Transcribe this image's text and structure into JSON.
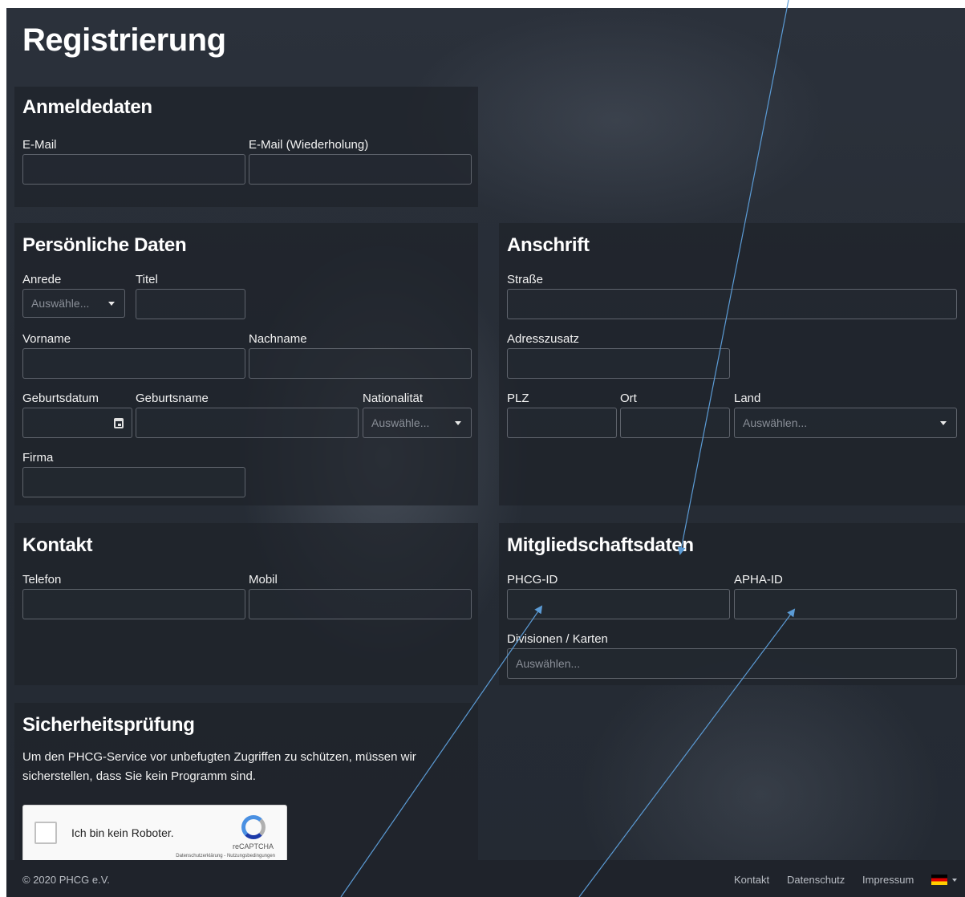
{
  "page_title": "Registrierung",
  "login": {
    "heading": "Anmeldedaten",
    "email_label": "E-Mail",
    "email_repeat_label": "E-Mail (Wiederholung)"
  },
  "personal": {
    "heading": "Persönliche Daten",
    "salutation_label": "Anrede",
    "salutation_placeholder": "Auswähle...",
    "title_label": "Titel",
    "firstname_label": "Vorname",
    "lastname_label": "Nachname",
    "birthdate_label": "Geburtsdatum",
    "birthname_label": "Geburtsname",
    "nationality_label": "Nationalität",
    "nationality_placeholder": "Auswähle...",
    "company_label": "Firma"
  },
  "address": {
    "heading": "Anschrift",
    "street_label": "Straße",
    "addition_label": "Adresszusatz",
    "zip_label": "PLZ",
    "city_label": "Ort",
    "country_label": "Land",
    "country_placeholder": "Auswählen..."
  },
  "contact": {
    "heading": "Kontakt",
    "phone_label": "Telefon",
    "mobile_label": "Mobil"
  },
  "membership": {
    "heading": "Mitgliedschaftsdaten",
    "phcg_label": "PHCG-ID",
    "apha_label": "APHA-ID",
    "divisions_label": "Divisionen / Karten",
    "divisions_placeholder": "Auswählen..."
  },
  "security": {
    "heading": "Sicherheitsprüfung",
    "text": "Um den PHCG-Service vor unbefugten Zugriffen zu schützen, müssen wir sicherstellen, dass Sie kein Programm sind."
  },
  "captcha": {
    "label": "Ich bin kein Roboter.",
    "brand": "reCAPTCHA",
    "terms": "Datenschutzerklärung - Nutzungsbedingungen"
  },
  "footer": {
    "copyright": "© 2020 PHCG e.V.",
    "links": [
      "Kontakt",
      "Datenschutz",
      "Impressum"
    ]
  },
  "colors": {
    "annotation_arrow": "#5b9bd5",
    "background": "#262c35"
  }
}
